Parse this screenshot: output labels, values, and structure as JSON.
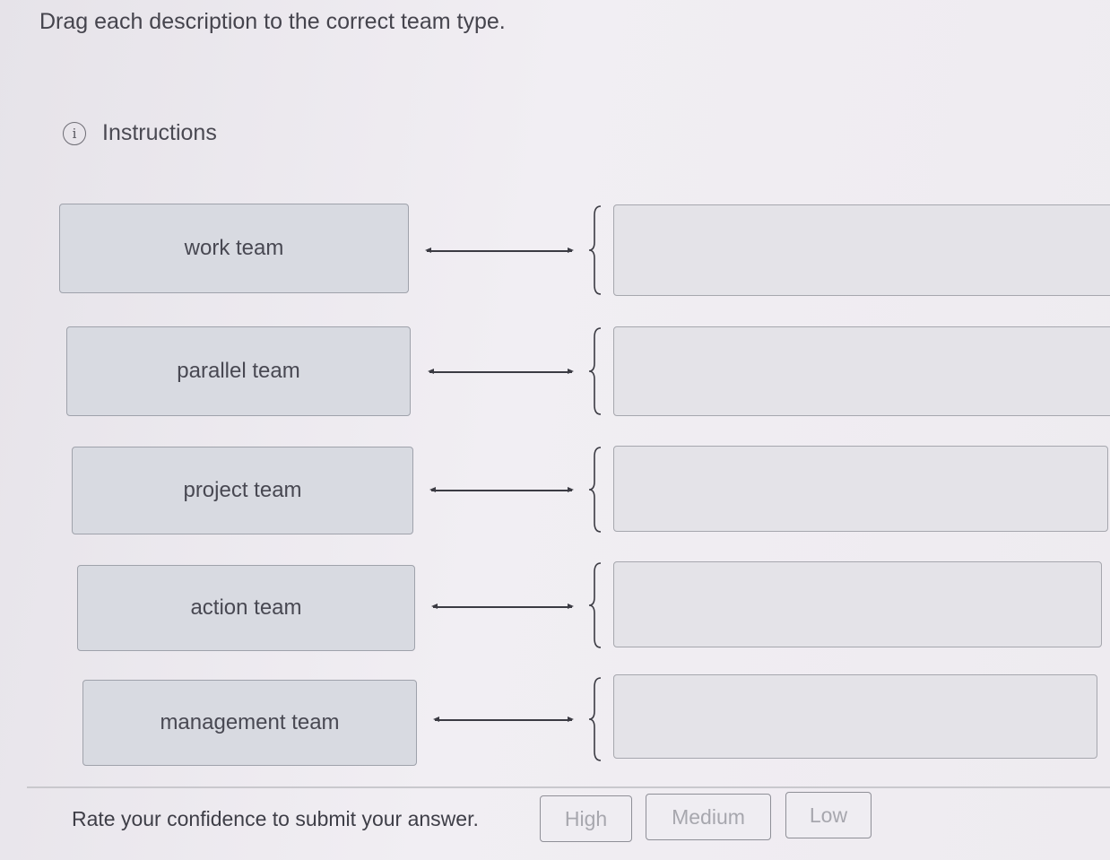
{
  "prompt": "Drag each description to the correct team type.",
  "instructions": {
    "label": "Instructions",
    "icon": "info-icon",
    "icon_glyph": "i"
  },
  "terms": [
    "work team",
    "parallel team",
    "project team",
    "action team",
    "management team"
  ],
  "drop_zones": [
    "",
    "",
    "",
    "",
    ""
  ],
  "confidence": {
    "label": "Rate your confidence to submit your answer.",
    "buttons": [
      "High",
      "Medium",
      "Low"
    ]
  },
  "colors": {
    "card_bg": "#d8dae1",
    "card_border": "#9fa2ab",
    "drop_bg": "#e4e3e8",
    "connector": "#3b3b43"
  }
}
